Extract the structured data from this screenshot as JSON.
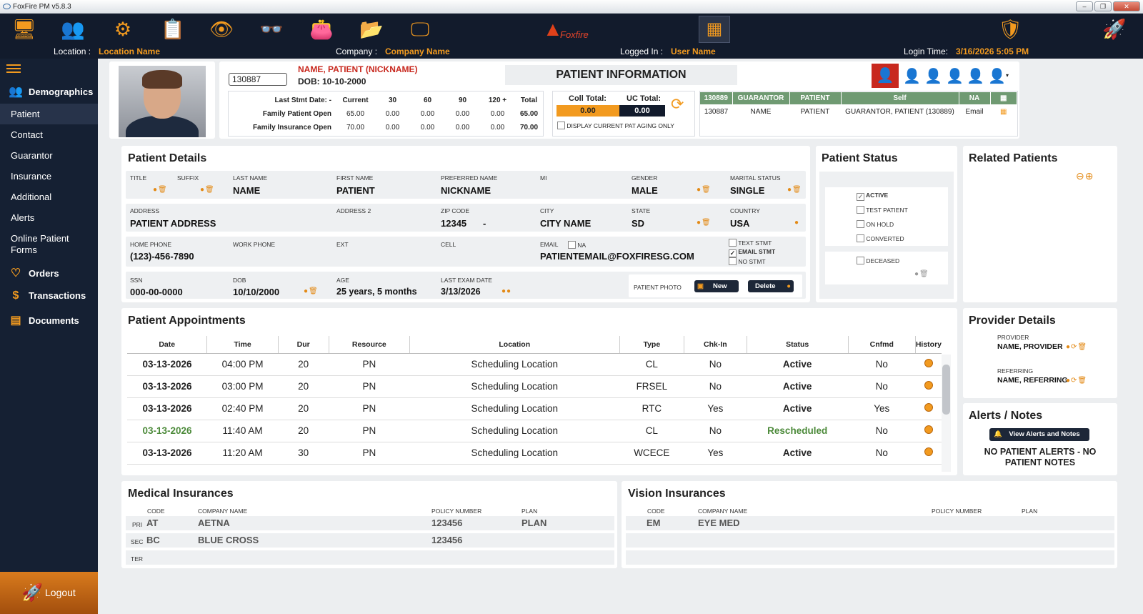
{
  "window": {
    "title": "FoxFire PM v5.8.3"
  },
  "brand": {
    "name": "Foxfire"
  },
  "infobar": {
    "location_label": "Location :",
    "location": "Location Name",
    "company_label": "Company :",
    "company": "Company Name",
    "logged_label": "Logged In :",
    "user": "User Name",
    "login_label": "Login Time:",
    "login_time": "3/16/2026 5:05 PM"
  },
  "sidebar": {
    "demographics": "Demographics",
    "items": [
      "Patient",
      "Contact",
      "Guarantor",
      "Insurance",
      "Additional",
      "Alerts",
      "Online Patient Forms"
    ],
    "orders": "Orders",
    "transactions": "Transactions",
    "documents": "Documents",
    "logout": "Logout"
  },
  "header": {
    "patient_id": "130887",
    "name": "NAME, PATIENT (NICKNAME)",
    "dob": "DOB:  10-10-2000",
    "panel_title": "PATIENT INFORMATION"
  },
  "aging": {
    "head": [
      "Last Stmt Date: -",
      "Current",
      "30",
      "60",
      "90",
      "120 +",
      "Total"
    ],
    "rows": [
      [
        "Family Patient Open",
        "65.00",
        "0.00",
        "0.00",
        "0.00",
        "0.00",
        "65.00"
      ],
      [
        "Family Insurance Open",
        "70.00",
        "0.00",
        "0.00",
        "0.00",
        "0.00",
        "70.00"
      ]
    ]
  },
  "coll": {
    "coll_label": "Coll Total:",
    "coll_value": "0.00",
    "uc_label": "UC Total:",
    "uc_value": "0.00",
    "display_label": "DISPLAY CURRENT PAT AGING ONLY"
  },
  "guarantor": {
    "head": [
      "130889",
      "GUARANTOR",
      "PATIENT",
      "Self",
      "NA"
    ],
    "row": [
      "130887",
      "NAME",
      "PATIENT",
      "GUARANTOR, PATIENT (130889)",
      "Email"
    ]
  },
  "details": {
    "title": "Patient Details",
    "title_label": "TITLE",
    "suffix_label": "SUFFIX",
    "last_label": "LAST NAME",
    "last": "NAME",
    "first_label": "FIRST NAME",
    "first": "PATIENT",
    "pref_label": "PREFERRED NAME",
    "pref": "NICKNAME",
    "mi_label": "MI",
    "gender_label": "GENDER",
    "gender": "MALE",
    "marital_label": "MARITAL STATUS",
    "marital": "SINGLE",
    "address_label": "ADDRESS",
    "address": "PATIENT ADDRESS",
    "address2_label": "ADDRESS 2",
    "zip_label": "ZIP CODE",
    "zip": "12345",
    "zip_dash": "-",
    "city_label": "CITY",
    "city": "CITY NAME",
    "state_label": "STATE",
    "state": "SD",
    "country_label": "COUNTRY",
    "country": "USA",
    "home_label": "HOME PHONE",
    "home": "(123)-456-7890",
    "work_label": "WORK PHONE",
    "ext_label": "EXT",
    "cell_label": "CELL",
    "email_label": "EMAIL",
    "na_label": "NA",
    "email": "PATIENTEMAIL@FOXFIRESG.COM",
    "text_stmt": "TEXT STMT",
    "email_stmt": "EMAIL STMT",
    "no_stmt": "NO STMT",
    "ssn_label": "SSN",
    "ssn": "000-00-0000",
    "dob_label": "DOB",
    "dob": "10/10/2000",
    "age_label": "AGE",
    "age": "25 years, 5 months",
    "exam_label": "LAST EXAM DATE",
    "exam": "3/13/2026",
    "photo_label": "PATIENT PHOTO",
    "new_btn": "New",
    "delete_btn": "Delete"
  },
  "status": {
    "title": "Patient Status",
    "items": [
      "ACTIVE",
      "TEST PATIENT",
      "ON HOLD",
      "CONVERTED"
    ],
    "deceased": "DECEASED"
  },
  "related": {
    "title": "Related Patients"
  },
  "appointments": {
    "title": "Patient Appointments",
    "head": [
      "Date",
      "Time",
      "Dur",
      "Resource",
      "Location",
      "Type",
      "Chk-In",
      "Status",
      "Cnfmd",
      "History"
    ],
    "rows": [
      [
        "03-13-2026",
        "04:00 PM",
        "20",
        "PN",
        "Scheduling Location",
        "CL",
        "No",
        "Active",
        "No"
      ],
      [
        "03-13-2026",
        "03:00 PM",
        "20",
        "PN",
        "Scheduling Location",
        "FRSEL",
        "No",
        "Active",
        "No"
      ],
      [
        "03-13-2026",
        "02:40 PM",
        "20",
        "PN",
        "Scheduling Location",
        "RTC",
        "Yes",
        "Active",
        "Yes"
      ],
      [
        "03-13-2026",
        "11:40 AM",
        "20",
        "PN",
        "Scheduling Location",
        "CL",
        "No",
        "Rescheduled",
        "No"
      ],
      [
        "03-13-2026",
        "11:20 AM",
        "30",
        "PN",
        "Scheduling Location",
        "WCECE",
        "Yes",
        "Active",
        "No"
      ]
    ]
  },
  "provider": {
    "title": "Provider Details",
    "provider_label": "PROVIDER",
    "provider": "NAME, PROVIDER",
    "referring_label": "REFERRING",
    "referring": "NAME, REFERRING"
  },
  "alerts": {
    "title": "Alerts / Notes",
    "button": "View Alerts and Notes",
    "message": "NO PATIENT ALERTS - NO PATIENT NOTES"
  },
  "medical": {
    "title": "Medical Insurances",
    "head": [
      "CODE",
      "COMPANY NAME",
      "POLICY NUMBER",
      "PLAN"
    ],
    "rows": [
      [
        "PRI",
        "AT",
        "AETNA",
        "123456",
        "PLAN"
      ],
      [
        "SEC",
        "BC",
        "BLUE CROSS",
        "123456",
        ""
      ],
      [
        "TER",
        "",
        "",
        "",
        ""
      ]
    ]
  },
  "vision": {
    "title": "Vision Insurances",
    "head": [
      "CODE",
      "COMPANY NAME",
      "POLICY NUMBER",
      "PLAN"
    ],
    "rows": [
      [
        "EM",
        "EYE MED",
        "",
        ""
      ]
    ]
  },
  "colors": {
    "accent": "#f29a1f",
    "navy": "#121b2c",
    "red": "#c8281e",
    "green": "#4c8a3a"
  }
}
